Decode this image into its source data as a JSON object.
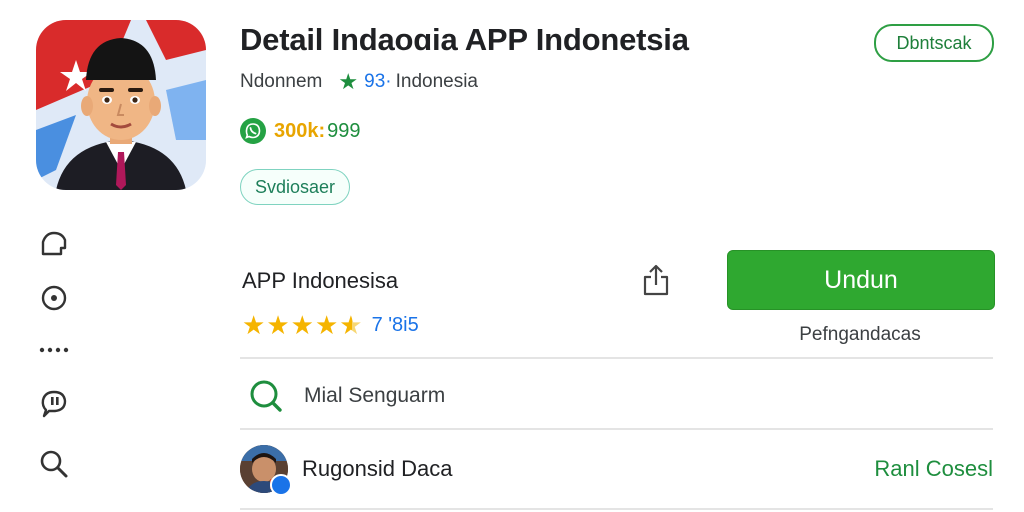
{
  "header": {
    "title": "Detail Indaoɑia APP Indonetsia",
    "developer": "Ndonnem",
    "rating": "93·",
    "country": "Indonesia",
    "downloads": "300k:",
    "count": "999",
    "chip": "Svdiosaer",
    "top_button": "Dbntscak"
  },
  "install": {
    "app_name": "APP Indonesisa",
    "stars": 4.5,
    "reviews": "7 '8i5",
    "button": "Undun",
    "subtext": "Pefngandacas"
  },
  "search": {
    "text": "Mial Senguarm"
  },
  "user": {
    "name": "Rugonsid Daca",
    "action": "Ranl Cosesl"
  },
  "icons": {
    "rail": [
      "home-icon",
      "info-icon",
      "more-icon",
      "chat-icon",
      "search-icon"
    ],
    "share": "share-icon",
    "search_row": "search-icon",
    "rating": "star-icon",
    "downloads": "whatsapp-icon"
  },
  "colors": {
    "accent": "#2fa830",
    "rating": "#1a73e8",
    "star": "#f5b400",
    "download": "#e8a500"
  }
}
